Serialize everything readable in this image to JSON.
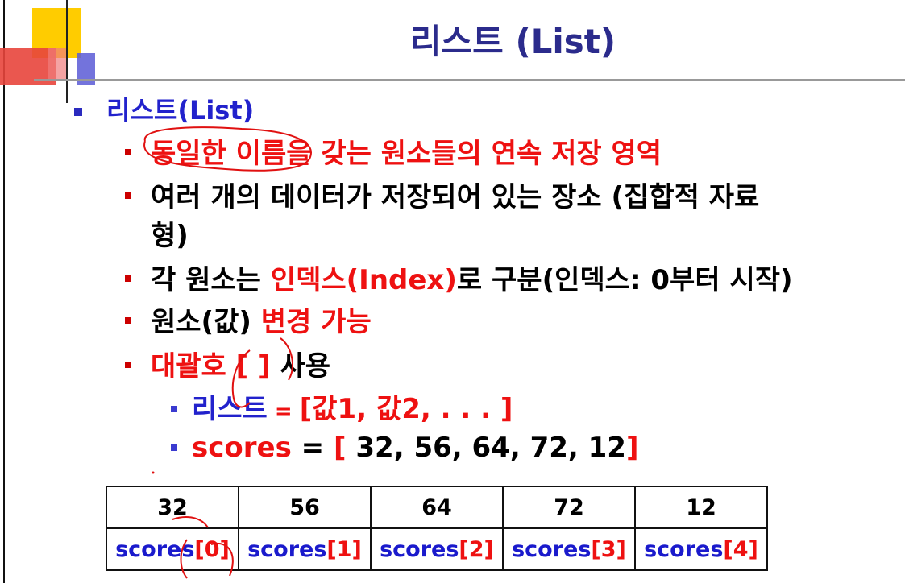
{
  "title": "리스트 (List)",
  "heading": "리스트(List)",
  "items": [
    {
      "text": "동일한 이름을 갖는 원소들의 연속 저장 영역"
    },
    {
      "line1": "여러 개의 데이터가 저장되어 있는 장소 (집합적 자료",
      "line2": "형)"
    },
    {
      "pre": "각 원소는 ",
      "hl": "인덱스(Index)",
      "post": "로 구분(인덱스: 0부터 시작)"
    },
    {
      "pre": "원소(값) ",
      "hl": "변경 가능"
    },
    {
      "hl": "대괄호 [ ] ",
      "post": "사용"
    }
  ],
  "sub_items": [
    {
      "name": "리스트",
      "eq": " = ",
      "value": "[값1, 값2, . . . ]"
    },
    {
      "name": "scores",
      "eq": "  = ",
      "open": "[",
      "values": " 32, 56, 64, 72, 12",
      "close": "]"
    }
  ],
  "table": {
    "values": [
      "32",
      "56",
      "64",
      "72",
      "12"
    ],
    "labels": [
      {
        "name": "scores",
        "idx": "[0]"
      },
      {
        "name": "scores",
        "idx": "[1]"
      },
      {
        "name": "scores",
        "idx": "[2]"
      },
      {
        "name": "scores",
        "idx": "[3]"
      },
      {
        "name": "scores",
        "idx": "[4]"
      }
    ]
  },
  "colors": {
    "title": "#2b2b8c",
    "highlight": "#ee1111",
    "heading": "#2222cc",
    "magenta": "#e020e0"
  }
}
